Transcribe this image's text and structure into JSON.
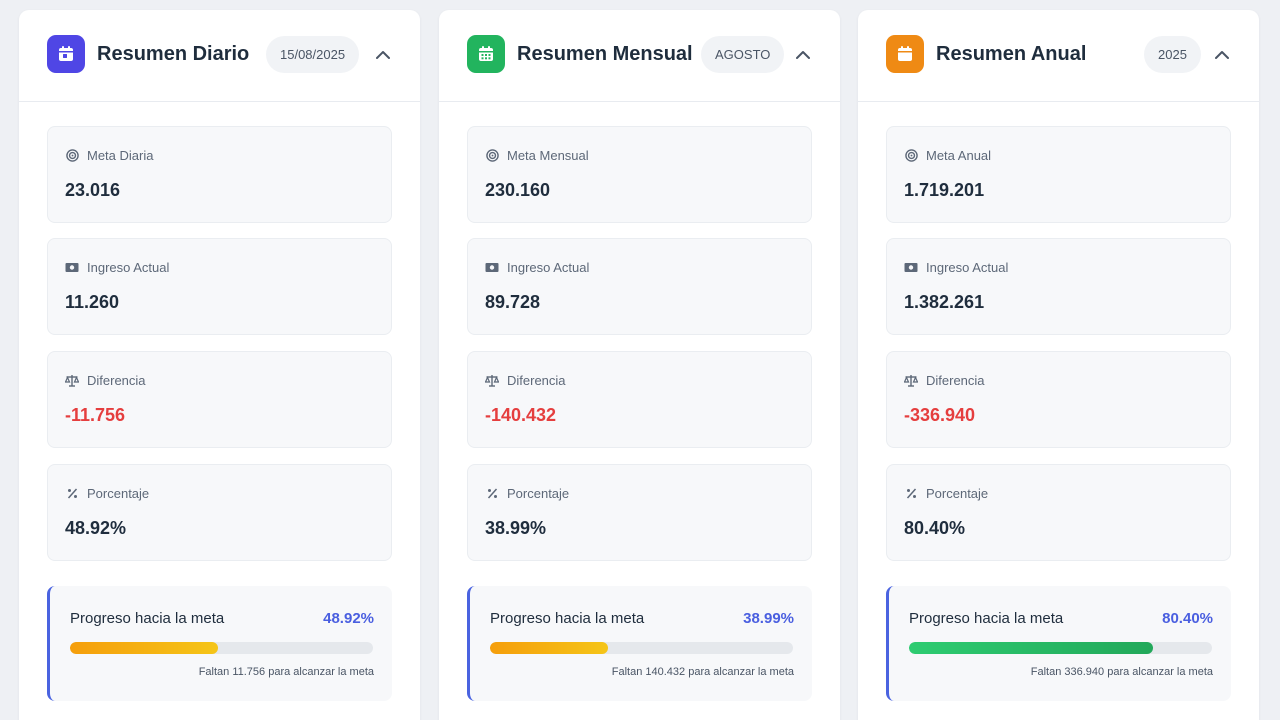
{
  "cards": [
    {
      "title": "Resumen Diario",
      "badge": "15/08/2025",
      "icon_color": "#4f46e5",
      "icon": "calendar-day-icon",
      "meta": {
        "label": "Meta Diaria",
        "value": "23.016"
      },
      "ingreso": {
        "label": "Ingreso Actual",
        "value": "11.260"
      },
      "diferencia": {
        "label": "Diferencia",
        "value": "-11.756"
      },
      "porcentaje": {
        "label": "Porcentaje",
        "value": "48.92%"
      },
      "progress": {
        "title": "Progreso hacia la meta",
        "percent_label": "48.92%",
        "fraction": 0.4892,
        "note": "Faltan 11.756 para alcanzar la meta"
      }
    },
    {
      "title": "Resumen Mensual",
      "badge": "AGOSTO",
      "icon_color": "#22b45e",
      "icon": "calendar-month-icon",
      "meta": {
        "label": "Meta Mensual",
        "value": "230.160"
      },
      "ingreso": {
        "label": "Ingreso Actual",
        "value": "89.728"
      },
      "diferencia": {
        "label": "Diferencia",
        "value": "-140.432"
      },
      "porcentaje": {
        "label": "Porcentaje",
        "value": "38.99%"
      },
      "progress": {
        "title": "Progreso hacia la meta",
        "percent_label": "38.99%",
        "fraction": 0.3899,
        "note": "Faltan 140.432 para alcanzar la meta"
      }
    },
    {
      "title": "Resumen Anual",
      "badge": "2025",
      "icon_color": "#ef8a14",
      "icon": "calendar-year-icon",
      "meta": {
        "label": "Meta Anual",
        "value": "1.719.201"
      },
      "ingreso": {
        "label": "Ingreso Actual",
        "value": "1.382.261"
      },
      "diferencia": {
        "label": "Diferencia",
        "value": "-336.940"
      },
      "porcentaje": {
        "label": "Porcentaje",
        "value": "80.40%"
      },
      "progress": {
        "title": "Progreso hacia la meta",
        "percent_label": "80.40%",
        "fraction": 0.804,
        "note": "Faltan 336.940 para alcanzar la meta"
      }
    }
  ],
  "colors": {
    "negative": "#e53e3e",
    "accent": "#4a5fe0",
    "progress_warn": "#f5b211",
    "progress_ok": "#2ecc71"
  }
}
